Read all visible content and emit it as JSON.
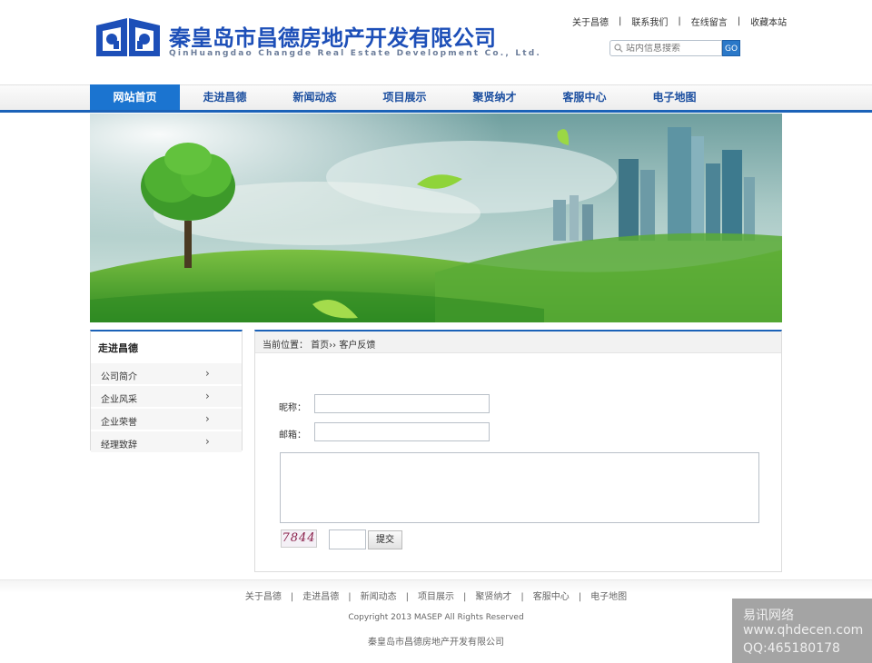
{
  "header": {
    "company_cn": "秦皇岛市昌德房地产开发有限公司",
    "company_en": "QinHuangdao Changde Real Estate Development Co., Ltd.",
    "top_links": [
      "关于昌德",
      "联系我们",
      "在线留言",
      "收藏本站"
    ],
    "search_placeholder": "站内信息搜索",
    "search_button": "GO"
  },
  "nav": {
    "items": [
      "网站首页",
      "走进昌德",
      "新闻动态",
      "项目展示",
      "聚贤纳才",
      "客服中心",
      "电子地图"
    ],
    "active": "网站首页"
  },
  "sidebar": {
    "title": "走进昌德",
    "items": [
      "公司简介",
      "企业风采",
      "企业荣誉",
      "经理致辞"
    ],
    "arrow": "›"
  },
  "content": {
    "breadcrumb": "当前位置： 首页›› 客户反馈",
    "nickname_label": "昵称：",
    "email_label": "邮箱：",
    "captcha_text": "7844",
    "submit_label": "提交"
  },
  "footer": {
    "links": [
      "关于昌德",
      "走进昌德",
      "新闻动态",
      "项目展示",
      "聚贤纳才",
      "客服中心",
      "电子地图"
    ],
    "copyright": "Copyright 2013 MASEP All Rights Reserved",
    "company": "秦皇岛市昌德房地产开发有限公司"
  },
  "watermark": {
    "line1": "易讯网络",
    "line2": "www.qhdecen.com",
    "line3": "QQ:465180178"
  },
  "colors": {
    "brand_blue": "#1d4fb8",
    "nav_active": "#1b74d0",
    "nav_text": "#1c4fa0"
  }
}
